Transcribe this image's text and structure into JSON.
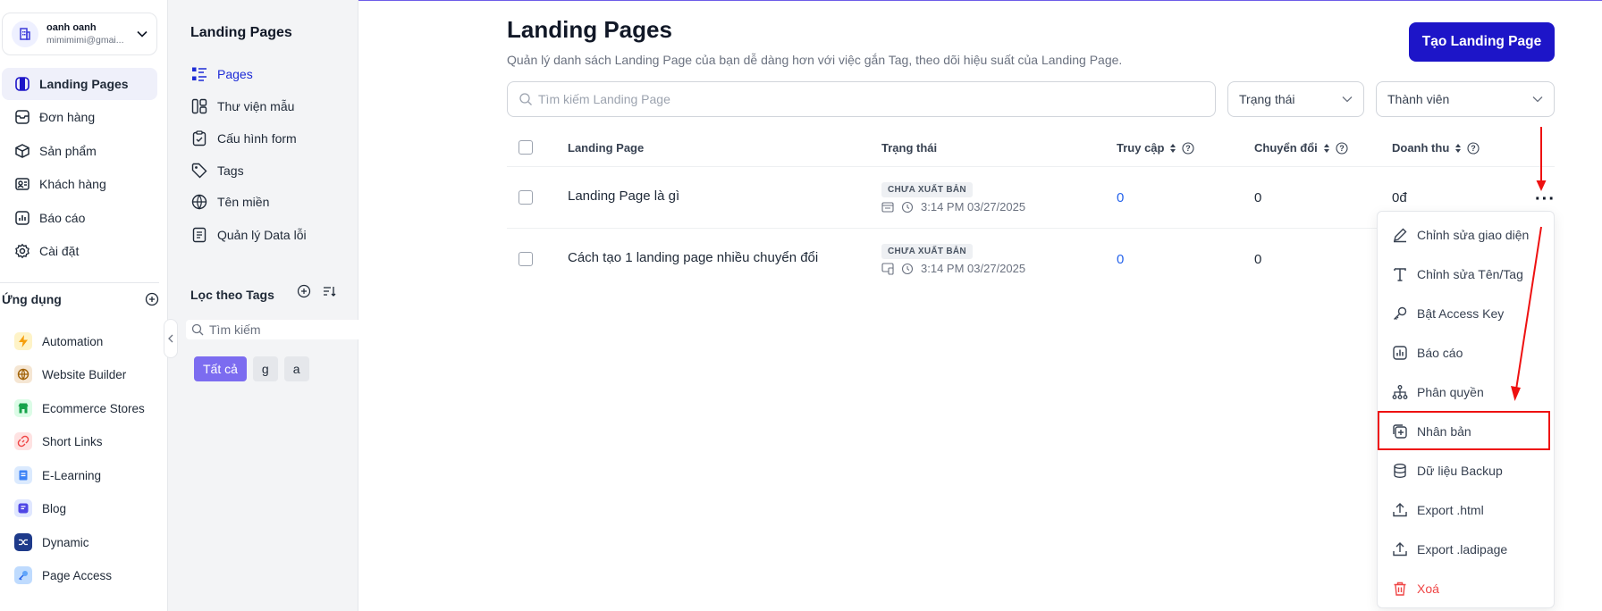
{
  "account": {
    "name": "oanh oanh",
    "email": "mimimimi@gmai..."
  },
  "nav": [
    {
      "label": "Landing Pages",
      "icon": "landing-pages-icon",
      "active": true
    },
    {
      "label": "Đơn hàng",
      "icon": "orders-icon"
    },
    {
      "label": "Sản phẩm",
      "icon": "box-icon"
    },
    {
      "label": "Khách hàng",
      "icon": "contacts-icon"
    },
    {
      "label": "Báo cáo",
      "icon": "report-icon"
    },
    {
      "label": "Cài đặt",
      "icon": "gear-icon"
    }
  ],
  "apps": {
    "title": "Ứng dụng",
    "items": [
      {
        "label": "Automation",
        "icon": "lightning-icon",
        "color": "#f59e0b"
      },
      {
        "label": "Website Builder",
        "icon": "globe-icon",
        "color": "#a16207"
      },
      {
        "label": "Ecommerce Stores",
        "icon": "store-icon",
        "color": "#16a34a"
      },
      {
        "label": "Short Links",
        "icon": "link-icon",
        "color": "#ef4444"
      },
      {
        "label": "E-Learning",
        "icon": "book-icon",
        "color": "#3b82f6"
      },
      {
        "label": "Blog",
        "icon": "blog-icon",
        "color": "#4f46e5"
      },
      {
        "label": "Dynamic",
        "icon": "shuffle-icon",
        "color": "#1e3a8a"
      },
      {
        "label": "Page Access",
        "icon": "key-icon",
        "color": "#60a5fa"
      }
    ]
  },
  "panel": {
    "title": "Landing Pages",
    "items": [
      {
        "label": "Pages",
        "icon": "list-icon",
        "active": true
      },
      {
        "label": "Thư viện mẫu",
        "icon": "template-icon"
      },
      {
        "label": "Cấu hình form",
        "icon": "clipboard-icon"
      },
      {
        "label": "Tags",
        "icon": "tag-icon"
      },
      {
        "label": "Tên miền",
        "icon": "domain-icon"
      },
      {
        "label": "Quản lý Data lỗi",
        "icon": "document-icon"
      }
    ],
    "filter_title": "Lọc theo Tags",
    "tag_search_placeholder": "Tìm kiếm",
    "chips": [
      "Tất cả",
      "g",
      "a"
    ]
  },
  "main": {
    "title": "Landing Pages",
    "subtitle": "Quản lý danh sách Landing Page của bạn dễ dàng hơn với việc gắn Tag, theo dõi hiệu suất của Landing Page.",
    "create_button": "Tạo Landing Page",
    "search_placeholder": "Tìm kiếm Landing Page",
    "status_select": "Trạng thái",
    "member_select": "Thành viên",
    "columns": [
      "Landing Page",
      "Trạng thái",
      "Truy cập",
      "Chuyển đổi",
      "Doanh thu"
    ],
    "rows": [
      {
        "name": "Landing Page là gì",
        "status": "CHƯA XUẤT BẢN",
        "time": "3:14 PM 03/27/2025",
        "visits": "0",
        "conversions": "0",
        "revenue": "0đ"
      },
      {
        "name": "Cách tạo 1 landing page nhiều chuyển đổi",
        "status": "CHƯA XUẤT BẢN",
        "time": "3:14 PM 03/27/2025",
        "visits": "0",
        "conversions": "0",
        "revenue": ""
      }
    ],
    "more_label": "···"
  },
  "menu": [
    {
      "label": "Chỉnh sửa giao diện",
      "icon": "pencil-icon"
    },
    {
      "label": "Chỉnh sửa Tên/Tag",
      "icon": "text-icon"
    },
    {
      "label": "Bật Access Key",
      "icon": "key-icon"
    },
    {
      "label": "Báo cáo",
      "icon": "report-icon"
    },
    {
      "label": "Phân quyền",
      "icon": "hierarchy-icon"
    },
    {
      "label": "Nhân bản",
      "icon": "duplicate-icon",
      "highlighted": true
    },
    {
      "label": "Dữ liệu Backup",
      "icon": "database-icon"
    },
    {
      "label": "Export .html",
      "icon": "upload-icon"
    },
    {
      "label": "Export .ladipage",
      "icon": "upload-icon"
    },
    {
      "label": "Xoá",
      "icon": "trash-icon",
      "danger": true
    }
  ],
  "colors": {
    "accent": "#1d15c8",
    "annotation": "#ee1111",
    "chip_active": "#7c6cf0"
  }
}
